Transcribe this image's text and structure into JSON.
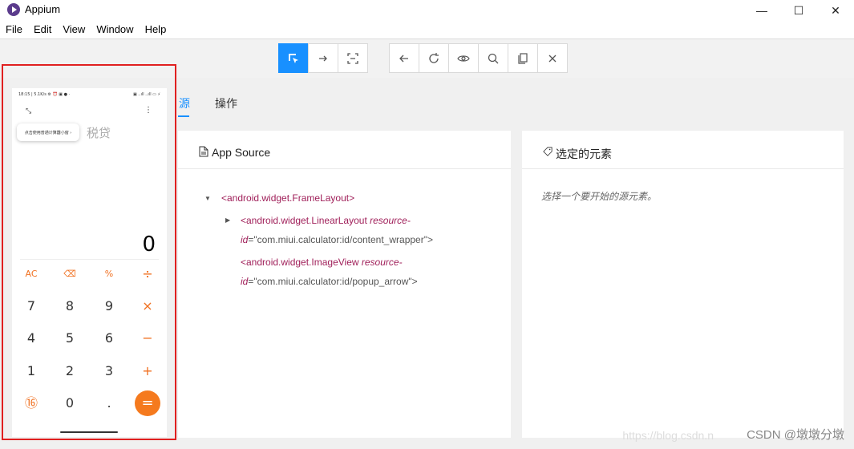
{
  "window": {
    "title": "Appium",
    "minimize": "—",
    "maximize": "☐",
    "close": "✕"
  },
  "menu": [
    "File",
    "Edit",
    "View",
    "Window",
    "Help"
  ],
  "device": {
    "status_left": "18:15 | 5.1K/s ⚙ ⏰ ▣ ● ·",
    "status_right": "▣ ..ıll ..ıll ▭ ⚡",
    "tooltip": "点击使用普通计算器小窗 ›",
    "tab": "税贷",
    "display": "0",
    "keys": {
      "ac": "AC",
      "backspace": "⌫",
      "percent": "%",
      "divide": "÷",
      "seven": "7",
      "eight": "8",
      "nine": "9",
      "multiply": "×",
      "four": "4",
      "five": "5",
      "six": "6",
      "minus": "−",
      "one": "1",
      "two": "2",
      "three": "3",
      "plus": "+",
      "convert": "⑯",
      "zero": "0",
      "dot": ".",
      "equals": "="
    }
  },
  "tabs": {
    "source": "源",
    "operations": "操作"
  },
  "app_source": {
    "title": "App Source",
    "tree": [
      {
        "tag": "<android.widget.FrameLayout>"
      },
      {
        "tag": "<android.widget.LinearLayout",
        "attr": "resource-",
        "attr2": "id",
        "val": "=\"com.miui.calculator:id/content_wrapper\">"
      },
      {
        "tag": "<android.widget.ImageView",
        "attr": "resource-",
        "attr2": "id",
        "val": "=\"com.miui.calculator:id/popup_arrow\">"
      }
    ]
  },
  "selected": {
    "title": "选定的元素",
    "hint": "选择一个要开始的源元素。"
  },
  "watermark": {
    "csdn": "CSDN @墩墩分墩",
    "faint": "https://blog.csdn.n"
  }
}
